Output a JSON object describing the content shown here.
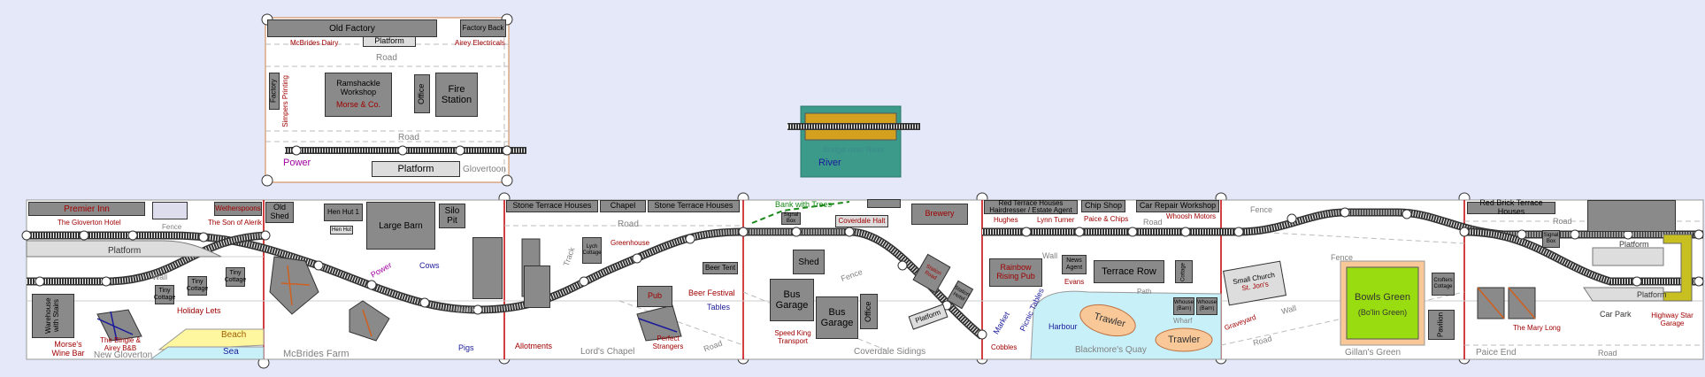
{
  "colors": {
    "background": "#e4e8f8",
    "board": "#ffffff",
    "building": "#8a8a8a",
    "module_edge": "#c00000",
    "water": "#c8f0f8",
    "bowls_green": "#99dd11",
    "beach": "#fff6a0",
    "trawler": "#f8c898",
    "river_bank": "#3c9a8a",
    "bridge": "#d4a020",
    "platform_yellow": "#c8c020"
  },
  "glover_top": {
    "old_factory": "Old Factory",
    "factory_back": "Factory Back",
    "mcbrides_dairy": "McBrides Dairy",
    "platform_top": "Platform",
    "airey_electricals": "Airey Electricals",
    "road_top": "Road",
    "factory": "Factory",
    "simpers_printing": "Simpers Printing",
    "ramshackle": "Ramshackle Workshop",
    "morse_co": "Morse & Co.",
    "office": "Office",
    "fire_station": "Fire Station",
    "road_mid": "Road",
    "power": "Power",
    "platform_bottom": "Platform",
    "glovertoon": "Glovertoon"
  },
  "river": {
    "bridge": "Bridge over River",
    "label": "River"
  },
  "main": {
    "premier_inn": "Premier Inn",
    "gloverton_hotel": "The Gloverton Hotel",
    "fence1": "Fence",
    "wetherspoons": "Wetherspoons",
    "son_of_alerik": "The Son of Alerik",
    "old_shed": "Old Shed",
    "hen_hut_1": "Hen Hut 1",
    "hen_hut": "Hen Hut",
    "large_barn": "Large Barn",
    "silo_pit": "Silo Pit",
    "platform_left": "Platform",
    "wall_left": "Wall",
    "tiny_cottage": "Tiny Cottage",
    "holiday_lets": "Holiday Lets",
    "warehouse": "Warehouse with Stairs",
    "bingle_airey": "The Bingle & Airey B&B",
    "morses_wine_bar": "Morse's Wine Bar",
    "new_gloverton": "New Gloverton",
    "beach": "Beach",
    "sea": "Sea",
    "mcbrides_farm": "McBrides Farm",
    "power_mid": "Power",
    "cows": "Cows",
    "track_farm": "Track",
    "pigs": "Pigs",
    "stone_terrace_1": "Stone Terrace Houses",
    "chapel": "Chapel",
    "stone_terrace_2": "Stone Terrace Houses",
    "road_chapel": "Road",
    "track_chapel": "Track",
    "greenhouse": "Greenhouse",
    "lych_cottage": "Lych Cottage",
    "allotments": "Allotments",
    "lords_chapel": "Lord's Chapel",
    "pub": "Pub",
    "perfect_strangers": "Perfect Strangers",
    "beer_tent": "Beer Tent",
    "beer_festival": "Beer Festival",
    "tables": "Tables",
    "road_lower": "Road",
    "bank_with_trees": "Bank with Trees",
    "signal_box": "Signal Box",
    "coverdale_halt": "Coverdale Halt",
    "brewery": "Brewery",
    "shed": "Shed",
    "bus_garage_1": "Bus Garage",
    "bus_garage_2": "Bus Garage",
    "office_cov": "Office",
    "speed_king": "Speed King Transport",
    "fence_cov": "Fence",
    "station_road": "Station Road",
    "station_hotel": "Station Hotel",
    "platform_cov": "Platform",
    "coverdale_sidings": "Coverdale Sidings",
    "red_terrace": "Red Terrace Houses",
    "hairdresser": "Hairdresser / Estate Agent",
    "chip_shop": "Chip Shop",
    "car_repair": "Car Repair Workshop",
    "hughes": "Hughes",
    "lynn_turner": "Lynn Turner",
    "paice_chips": "Paice & Chips",
    "whoosh_motors": "Whoosh Motors",
    "road_harbour": "Road",
    "rainbow_pub": "Rainbow Rising Pub",
    "wall_harbour": "Wall",
    "news_agent": "News Agent",
    "evans": "Evans",
    "terrace_row": "Terrace Row",
    "path": "Path",
    "cottage": "Cottage",
    "market": "Market",
    "picnic_tables": "Picnic Tables",
    "harbour": "Harbour",
    "trawler_1": "Trawler",
    "trawler_2": "Trawler",
    "whouse_1": "Whouse (Barn)",
    "whouse_2": "Whouse (Barn)",
    "wharf": "Wharf",
    "cobbles": "Cobbles",
    "blackmores_quay": "Blackmore's Quay",
    "fence_church": "Fence",
    "small_church": "Small Church",
    "st_jons": "St. Jon's",
    "graveyard": "Graveyard",
    "wall_church": "Wall",
    "road_church": "Road",
    "fence_bowls": "Fence",
    "bowls_green": "Bowls Green",
    "bolin_green": "(Bo'lin Green)",
    "gillans_green": "Gillan's Green",
    "crofters_cottage": "Crofters Cottage",
    "pavilion": "Pavilion",
    "red_brick": "Red Brick Terrace Houses",
    "road_paice": "Road",
    "signal_box_2": "Signal Box",
    "platform_right": "Platform",
    "platform_right_2": "Platform",
    "mary_long": "The Mary Long",
    "car_park": "Car Park",
    "highway_star": "Highway Star Garage",
    "paice_end": "Paice End",
    "road_bottom": "Road"
  }
}
